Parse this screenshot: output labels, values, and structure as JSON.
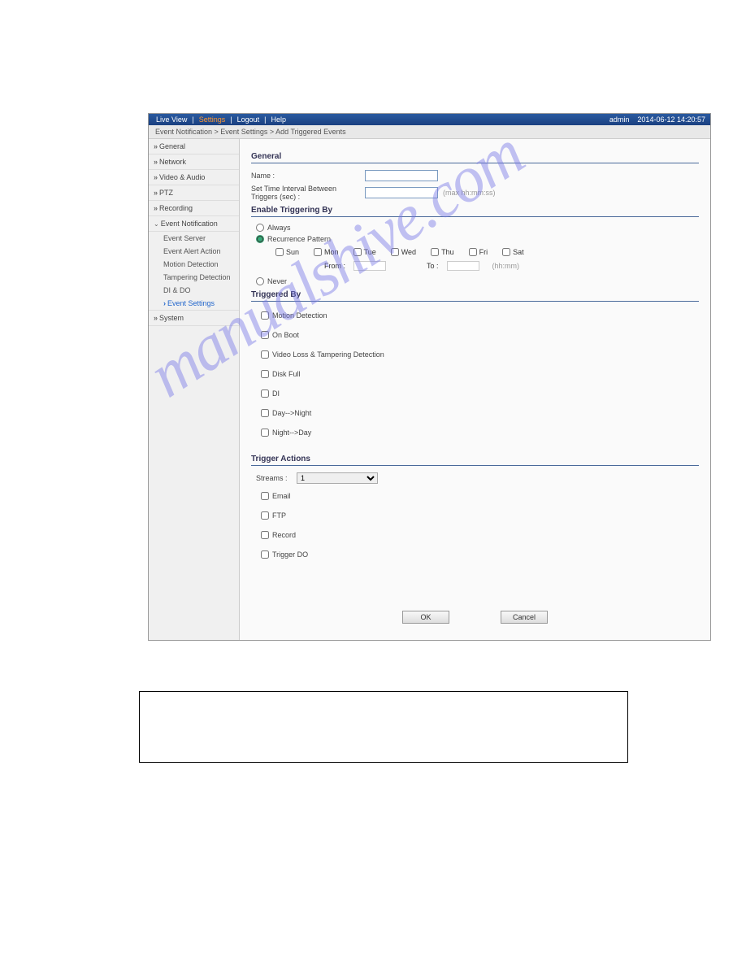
{
  "topbar": {
    "items": [
      "Live View",
      "Settings",
      "Logout",
      "Help"
    ],
    "user": "admin",
    "datetime": "2014-06-12  14:20:57"
  },
  "breadcrumb": "Event Notification > Event Settings > Add Triggered Events",
  "sidebar": {
    "items": [
      {
        "label": "General"
      },
      {
        "label": "Network"
      },
      {
        "label": "Video & Audio"
      },
      {
        "label": "PTZ"
      },
      {
        "label": "Recording"
      },
      {
        "label": "Event Notification",
        "expanded": true,
        "subs": [
          {
            "label": "Event Server"
          },
          {
            "label": "Event Alert Action"
          },
          {
            "label": "Motion Detection"
          },
          {
            "label": "Tampering Detection"
          },
          {
            "label": "DI & DO"
          },
          {
            "label": "Event Settings",
            "active": true
          }
        ]
      },
      {
        "label": "System"
      }
    ]
  },
  "sections": {
    "general": {
      "title": "General",
      "name_label": "Name :",
      "name_value": "",
      "interval_label": "Set Time Interval Between Triggers (sec) :",
      "interval_value": "",
      "interval_hint": "(max hh:mm:ss)"
    },
    "enable": {
      "title": "Enable Triggering By",
      "always": "Always",
      "recurrence": "Recurrence Pattern",
      "days": [
        "Sun",
        "Mon",
        "Tue",
        "Wed",
        "Thu",
        "Fri",
        "Sat"
      ],
      "from": "From :",
      "to": "To :",
      "time_hint": "(hh:mm)",
      "never": "Never"
    },
    "triggered_by": {
      "title": "Triggered By",
      "items": [
        "Motion Detection",
        "On Boot",
        "Video Loss & Tampering Detection",
        "Disk Full",
        "DI",
        "Day-->Night",
        "Night-->Day"
      ]
    },
    "trigger_actions": {
      "title": "Trigger Actions",
      "streams_label": "Streams :",
      "streams_value": "1",
      "items": [
        "Email",
        "FTP",
        "Record",
        "Trigger DO"
      ]
    }
  },
  "buttons": {
    "ok": "OK",
    "cancel": "Cancel"
  },
  "watermark": "manualshive.com"
}
